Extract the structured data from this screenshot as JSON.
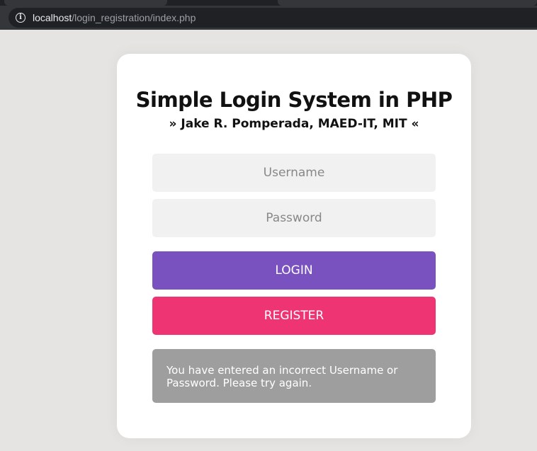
{
  "browser": {
    "url_host": "localhost",
    "url_path": "/login_registration/index.php"
  },
  "login": {
    "title": "Simple Login System in PHP",
    "subtitle": "» Jake R. Pomperada, MAED-IT, MIT «",
    "username_placeholder": "Username",
    "username_value": "",
    "password_placeholder": "Password",
    "password_value": "",
    "login_label": "LOGIN",
    "register_label": "REGISTER",
    "error_message": "You have entered an incorrect Username or Password. Please try again."
  },
  "icons": {
    "site_info": "info-icon"
  },
  "colors": {
    "page_background": "#e5e4e2",
    "login_button": "#7952c0",
    "register_button": "#ee3472",
    "alert_background": "#9e9e9e"
  }
}
